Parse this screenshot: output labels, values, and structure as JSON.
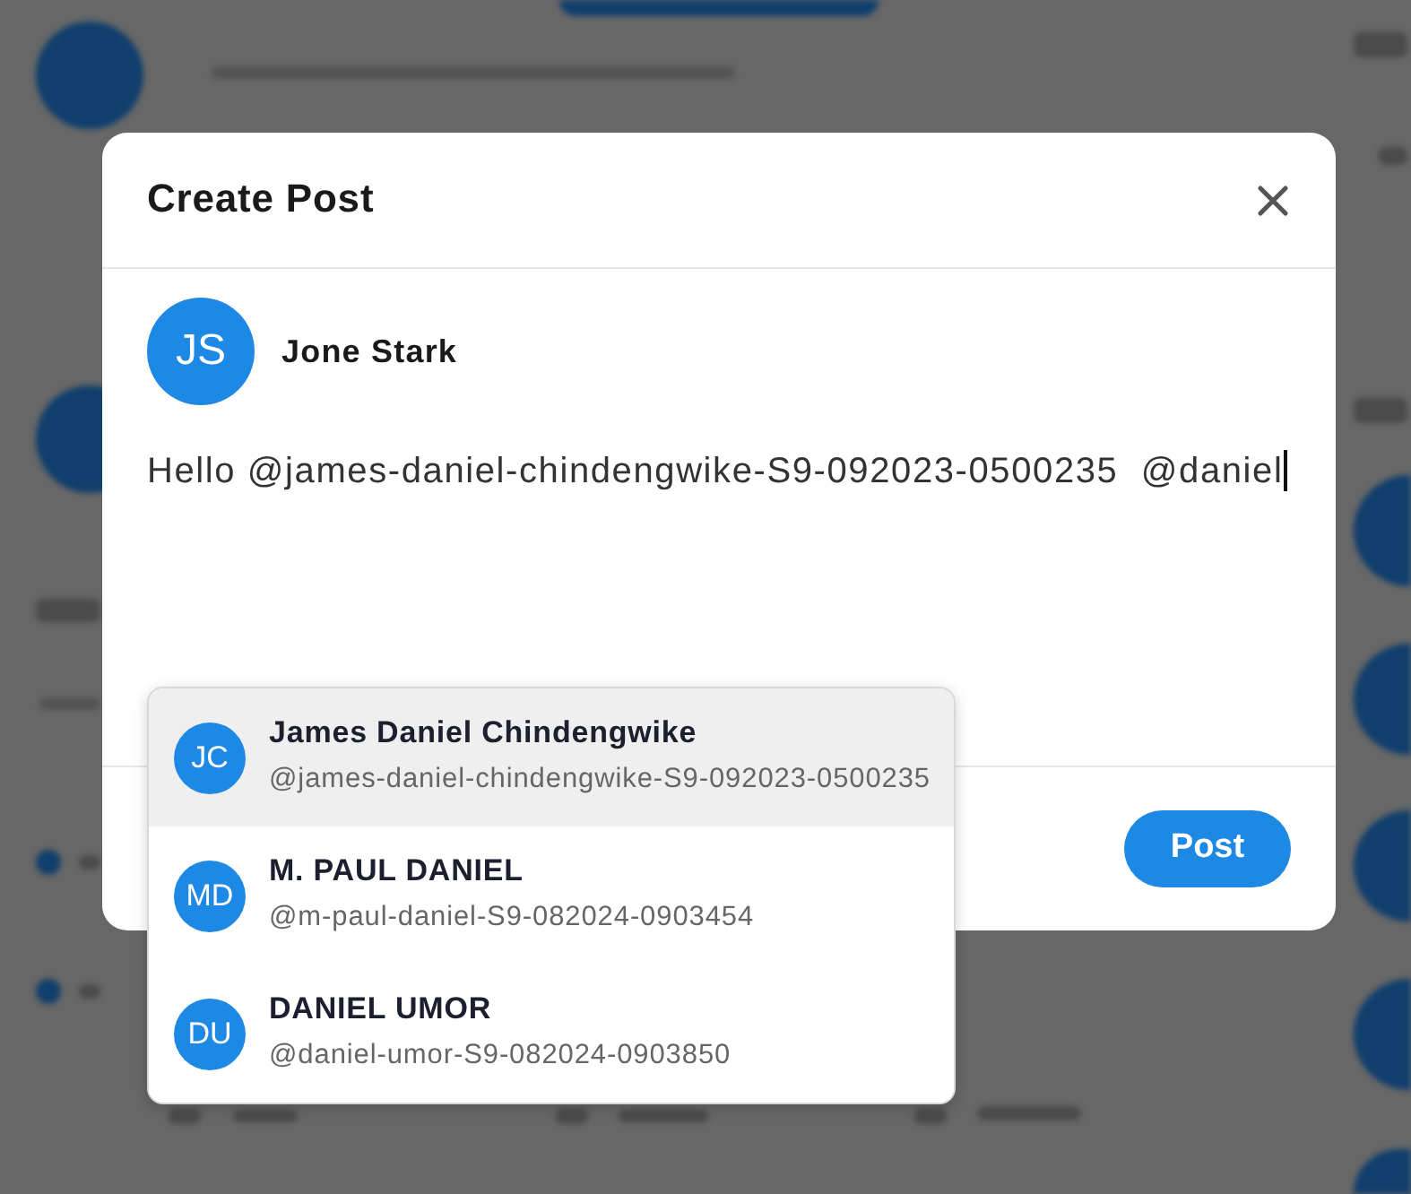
{
  "dialog": {
    "title": "Create Post",
    "author": {
      "initials": "JS",
      "name": "Jone Stark"
    },
    "post_text": "Hello @james-daniel-chindengwike-S9-092023-0500235  @daniel",
    "post_button": "Post"
  },
  "mention_suggestions": [
    {
      "initials": "JC",
      "name": "James Daniel Chindengwike",
      "handle": "@james-daniel-chindengwike-S9-092023-0500235",
      "selected": true
    },
    {
      "initials": "MD",
      "name": "M. PAUL DANIEL",
      "handle": "@m-paul-daniel-S9-082024-0903454",
      "selected": false
    },
    {
      "initials": "DU",
      "name": "DANIEL UMOR",
      "handle": "@daniel-umor-S9-082024-0903850",
      "selected": false
    }
  ]
}
